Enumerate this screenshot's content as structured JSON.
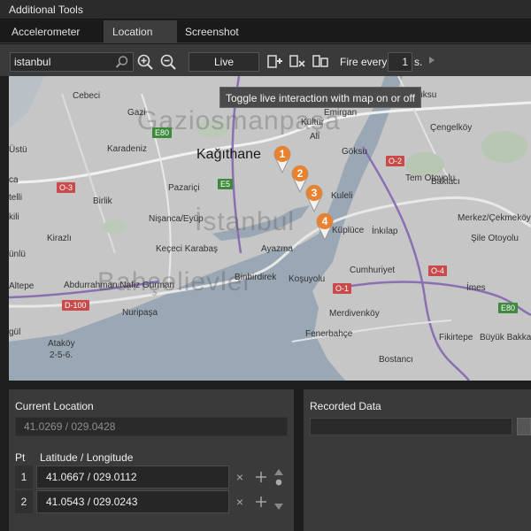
{
  "window": {
    "title": "Additional Tools"
  },
  "tabs": [
    {
      "label": "Accelerometer"
    },
    {
      "label": "Location"
    },
    {
      "label": "Screenshot"
    }
  ],
  "toolbar": {
    "search_value": "istanbul",
    "live_label": "Live",
    "fire_label": "Fire every",
    "fire_value": "1",
    "fire_unit": "s.",
    "tooltip": "Toggle live interaction with map on or off"
  },
  "map": {
    "labels": {
      "cebeci": "Cebeci",
      "gazi": "Gazi",
      "karadeniz": "Karadeniz",
      "kagithane": "Kağıthane",
      "pazarici": "Pazariçi",
      "birlik": "Birlik",
      "nisanca": "Nişanca/Eyüp",
      "kirazli": "Kirazlı",
      "kececi": "Keçeci Karabaş",
      "abdurrahman": "Abdurrahman Nafiz Gürman",
      "nuripasa": "Nuripaşa",
      "atakoy": "Ataköy",
      "atakoy2": "2-5-6.",
      "ayazma": "Ayazma",
      "binbirdirek": "Binbirdirek",
      "kosuyolu": "Koşuyolu",
      "mahmutbey": "Kültür",
      "emirgan": "Emirgan",
      "kuleli": "Kuleli",
      "goksu": "Göksu",
      "kupluce": "Küplüce",
      "inkilap": "İnkılap",
      "cumhuriyet": "Cumhuriyet",
      "merdivenkoy": "Merdivenköy",
      "fikirtepe": "Fikirtepe",
      "fenerbahce": "Fenerbahçe",
      "bostanci": "Bostancı",
      "imes": "İmes",
      "bakirkoy": "Büyük Bakkalköy",
      "baklaci": "Baklacı",
      "cengelkoy": "Çengelköy",
      "merkez": "Merkez/Çekmeköy",
      "sile": "Şile Otoyolu",
      "tem": "Tem Otoyolu",
      "kucuksu": "Küçüksu",
      "ustu": "Üstü",
      "aktepe": "Altepe",
      "telli": "telli",
      "kili": "kili",
      "gul": "gül",
      "ca": "ca",
      "ali": "Ali",
      "unlu": "ünlü"
    },
    "watermarks": [
      "Gaziosmanpaşa",
      "İstanbul",
      "Bahçelievler"
    ],
    "road_signs": [
      "E80",
      "E5",
      "O-3",
      "O-2",
      "O-1",
      "O-4",
      "D-100",
      "E80"
    ],
    "pins": [
      "1",
      "2",
      "3",
      "4"
    ]
  },
  "current_location": {
    "title": "Current Location",
    "value": "41.0269 /  029.0428"
  },
  "points_table": {
    "col_pt": "Pt",
    "col_latlon": "Latitude / Longitude",
    "rows": [
      {
        "pt": "1",
        "value": "41.0667 /  029.0112"
      },
      {
        "pt": "2",
        "value": "41.0543 /  029.0243"
      }
    ]
  },
  "recorded": {
    "title": "Recorded Data"
  },
  "colors": {
    "accent": "#e8822e",
    "panel": "#3a3a3a",
    "map_bg": "#c6c6c6",
    "water": "#9aa7b4"
  }
}
